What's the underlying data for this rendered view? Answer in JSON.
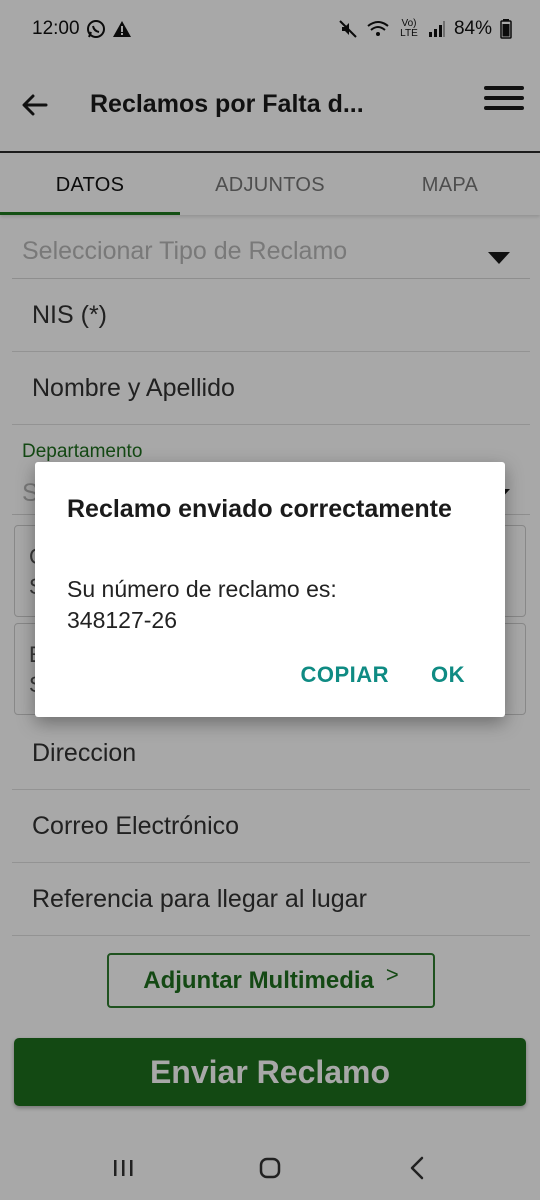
{
  "status_bar": {
    "time": "12:00",
    "battery": "84%",
    "network": "Vo) LTE"
  },
  "app_bar": {
    "title": "Reclamos por Falta d..."
  },
  "tabs": [
    {
      "label": "DATOS"
    },
    {
      "label": "ADJUNTOS"
    },
    {
      "label": "MAPA"
    }
  ],
  "form": {
    "type_placeholder": "Seleccionar Tipo de Reclamo",
    "nis_label": "NIS (*)",
    "name_label": "Nombre y Apellido",
    "department_label": "Departamento",
    "department_partial": "S",
    "box1_line1": "C",
    "box1_line2": "S",
    "box2_line1": "E",
    "box2_line2": "S",
    "address_label": "Direccion",
    "email_label": "Correo Electrónico",
    "reference_label": "Referencia para llegar al lugar",
    "attach_button": "Adjuntar Multimedia",
    "attach_chevron": ">",
    "submit_button": "Enviar Reclamo"
  },
  "dialog": {
    "title": "Reclamo enviado correctamente",
    "message_line1": "Su número de reclamo es:",
    "message_line2": "348127-26",
    "copy_button": "COPIAR",
    "ok_button": "OK"
  },
  "colors": {
    "primary_green": "#1e6f1e",
    "dialog_accent": "#0f8b83"
  }
}
